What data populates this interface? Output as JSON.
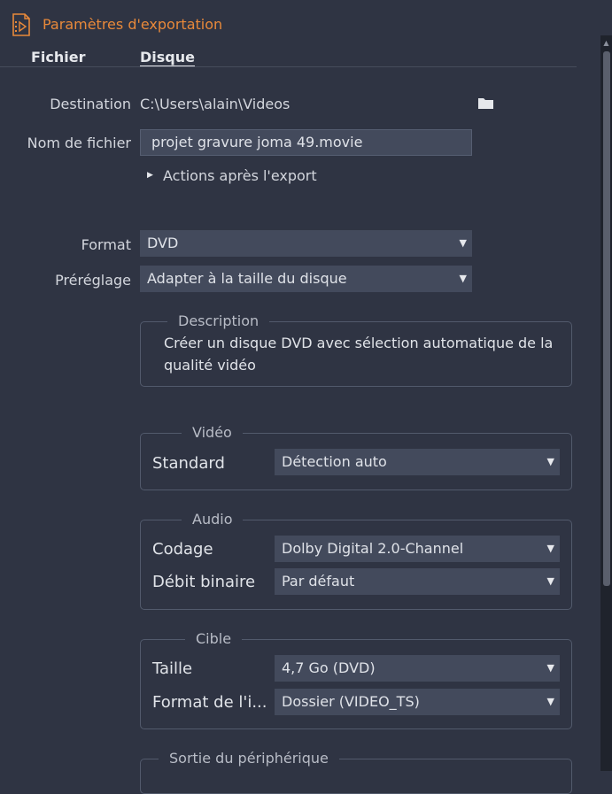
{
  "header": {
    "title": "Paramètres d'exportation",
    "icon": "export-film-icon",
    "accent": "#e8893a"
  },
  "tabs": [
    {
      "label": "Fichier"
    },
    {
      "label": "Disque"
    }
  ],
  "destination": {
    "label": "Destination",
    "value": "C:\\Users\\alain\\Videos",
    "browse_icon": "folder-icon"
  },
  "filename": {
    "label": "Nom de fichier",
    "value": "projet gravure joma 49.movie"
  },
  "post_export": {
    "label": "Actions après l'export"
  },
  "format": {
    "label": "Format",
    "value": "DVD"
  },
  "preset": {
    "label": "Préréglage",
    "value": "Adapter à la taille du disque"
  },
  "description": {
    "legend": "Description",
    "text_line1": "Créer un disque DVD avec sélection automatique de la",
    "text_line2": "qualité vidéo"
  },
  "video": {
    "legend": "Vidéo",
    "standard_label": "Standard",
    "standard_value": "Détection auto"
  },
  "audio": {
    "legend": "Audio",
    "codec_label": "Codage",
    "codec_value": "Dolby Digital 2.0-Channel",
    "bitrate_label": "Débit binaire",
    "bitrate_value": "Par défaut"
  },
  "target": {
    "legend": "Cible",
    "size_label": "Taille",
    "size_value": "4,7 Go (DVD)",
    "imgformat_label": "Format de l'i...",
    "imgformat_value": "Dossier (VIDEO_TS)"
  },
  "device_output": {
    "legend": "Sortie du périphérique"
  }
}
